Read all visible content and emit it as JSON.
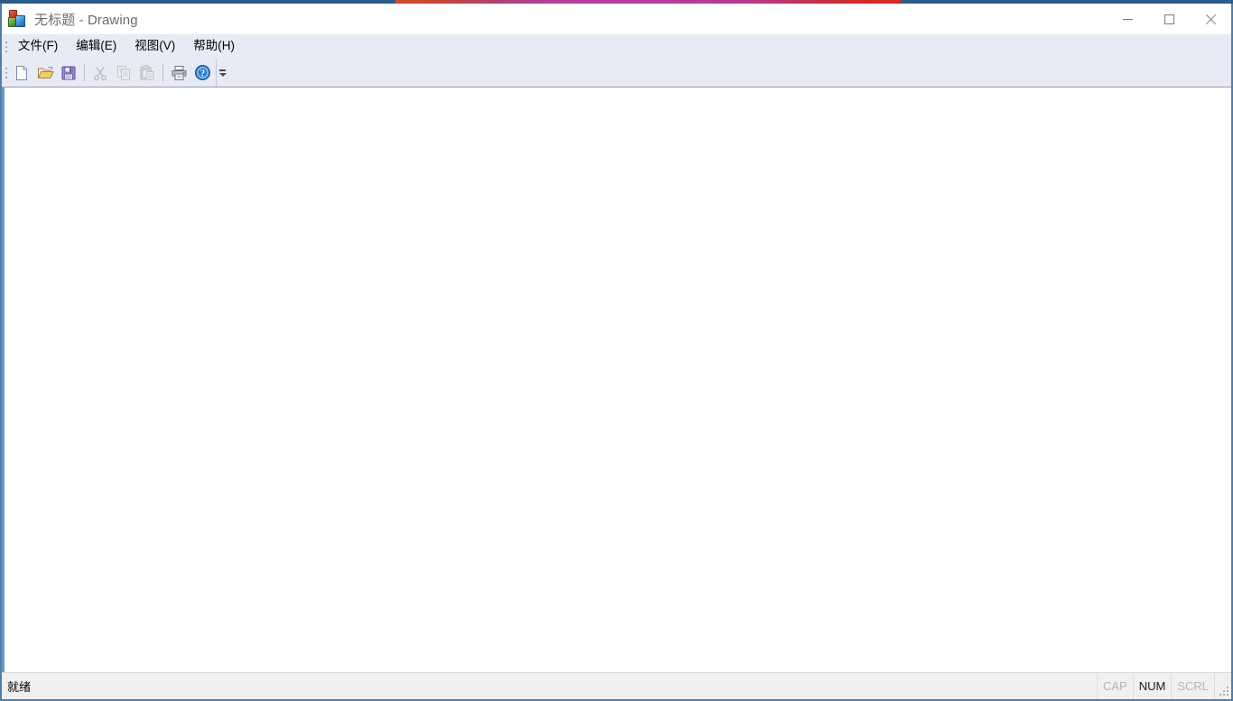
{
  "window": {
    "title_document": "无标题",
    "title_separator": " - ",
    "title_app": "Drawing",
    "app_icon": "office-blocks-icon",
    "frame_color": "#2b5d8c",
    "frame_side_color": "#4a7fb0",
    "controls": {
      "minimize_label": "最小化",
      "maximize_label": "最大化",
      "close_label": "关闭"
    }
  },
  "menubar": {
    "gripper": "menu-gripper",
    "items": [
      {
        "label": "文件(F)",
        "name": "menu-file"
      },
      {
        "label": "编辑(E)",
        "name": "menu-edit"
      },
      {
        "label": "视图(V)",
        "name": "menu-view"
      },
      {
        "label": "帮助(H)",
        "name": "menu-help"
      }
    ]
  },
  "toolbar": {
    "gripper": "toolbar-gripper",
    "background": "#e8eaf6",
    "buttons": [
      {
        "name": "new-icon",
        "label": "新建",
        "enabled": true
      },
      {
        "name": "open-icon",
        "label": "打开",
        "enabled": true
      },
      {
        "name": "save-icon",
        "label": "保存",
        "enabled": true
      },
      {
        "name": "cut-icon",
        "label": "剪切",
        "enabled": false
      },
      {
        "name": "copy-icon",
        "label": "复制",
        "enabled": false
      },
      {
        "name": "paste-icon",
        "label": "粘贴",
        "enabled": false
      },
      {
        "name": "print-icon",
        "label": "打印",
        "enabled": true
      },
      {
        "name": "help-icon",
        "label": "帮助",
        "enabled": true
      }
    ],
    "overflow_label": "工具栏选项"
  },
  "client": {
    "name": "drawing-canvas",
    "background": "#ffffff",
    "content": ""
  },
  "statusbar": {
    "message": "就绪",
    "indicators": [
      {
        "label": "CAP",
        "active": false
      },
      {
        "label": "NUM",
        "active": true
      },
      {
        "label": "SCRL",
        "active": false
      }
    ],
    "grip": "resize-grip"
  }
}
